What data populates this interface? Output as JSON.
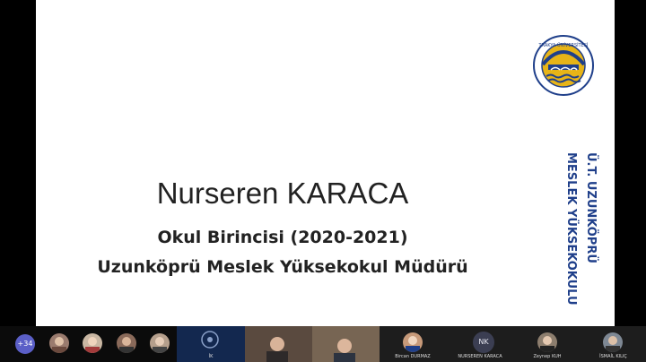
{
  "slide": {
    "name": "Nurseren KARACA",
    "line1": "Okul Birincisi (2020-2021)",
    "line2": "Uzunköprü Meslek Yüksekokul Müdürü",
    "vertical_text_1": "MESLEK YÜKSEKOKULU",
    "vertical_text_2": "Ü.T. UZUNKÖPRÜ",
    "logo_text": "TRAKYA ÜNİVERSİTESİ"
  },
  "strip": {
    "more_count": "+34",
    "participants": [
      {
        "id": "p5",
        "label": "Bircan DURMAZ"
      },
      {
        "id": "p6",
        "initials": "NK",
        "label": "NURSEREN KARACA"
      },
      {
        "id": "p7",
        "label": "Zeynep KUH"
      },
      {
        "id": "p8",
        "label": "İSMAİL KILIÇ"
      }
    ],
    "video_tile_label": "İK"
  },
  "colors": {
    "accent": "#5b5fc7",
    "navy": "#1f3f8a",
    "gold": "#e7b417"
  }
}
